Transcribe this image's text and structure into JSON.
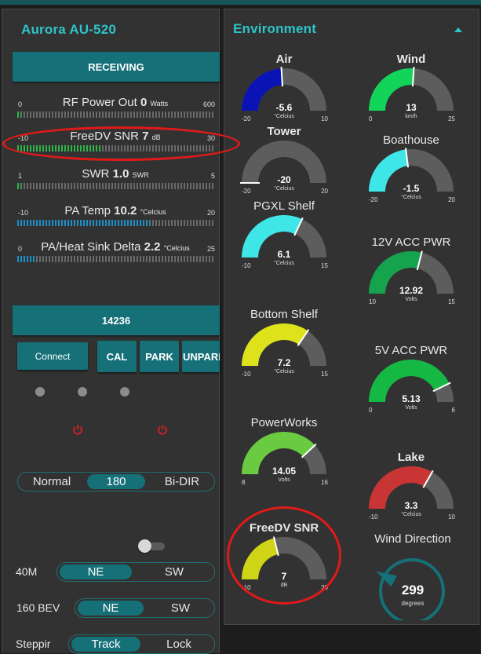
{
  "colors": {
    "accent": "#157078",
    "title": "#2ec4c9",
    "panel": "#323232",
    "highlight": "#e01a1a"
  },
  "left": {
    "title": "Aurora AU-520",
    "status": "RECEIVING",
    "meters": [
      {
        "label": "RF Power Out ",
        "value": "0",
        "unit": "Watts",
        "min": "0",
        "max": "600",
        "fill": 0.0,
        "color": "#2fb54a"
      },
      {
        "label": "FreeDV SNR ",
        "value": "7",
        "unit": "dB",
        "min": "-10",
        "max": "30",
        "fill": 0.42,
        "color": "#2fb54a"
      },
      {
        "label": "SWR ",
        "value": "1.0",
        "unit": "SWR",
        "min": "1",
        "max": "5",
        "fill": 0.02,
        "color": "#2fb54a"
      },
      {
        "label": "PA Temp ",
        "value": "10.2",
        "unit": "°Celcius",
        "min": "-10",
        "max": "20",
        "fill": 0.67,
        "color": "#1f8fc9"
      },
      {
        "label": "PA/Heat Sink Delta ",
        "value": "2.2",
        "unit": "°Celcius",
        "min": "0",
        "max": "25",
        "fill": 0.09,
        "color": "#1f8fc9"
      }
    ],
    "frequency": "14236",
    "buttons": {
      "connect": "Connect",
      "cal": "CAL",
      "park": "PARK",
      "unpark": "UNPARK"
    },
    "mode": {
      "left": "Normal",
      "middle": "180",
      "right": "Bi-DIR"
    },
    "rows": [
      {
        "label": "40M",
        "a": "NE",
        "b": "SW"
      },
      {
        "label": "160 BEV",
        "a": "NE",
        "b": "SW"
      },
      {
        "label": "Steppir",
        "a": "Track",
        "b": "Lock"
      }
    ]
  },
  "environment": {
    "title": "Environment",
    "collapse_icon": "caret-up-icon",
    "gauges": [
      {
        "title": "Air",
        "value": "-5.6",
        "unit": "°Celcius",
        "min": "-20",
        "max": "10",
        "fraction": 0.48,
        "color": "#0a14b4"
      },
      {
        "title": "Wind",
        "value": "13",
        "unit": "km/h",
        "min": "0",
        "max": "25",
        "fraction": 0.52,
        "color": "#12d45a"
      },
      {
        "title": "Tower",
        "value": "-20",
        "unit": "°Celcius",
        "min": "-20",
        "max": "20",
        "fraction": 0.0,
        "color": "#e0e0e0"
      },
      {
        "title": "Boathouse",
        "value": "-1.5",
        "unit": "°Celcius",
        "min": "-20",
        "max": "20",
        "fraction": 0.46,
        "color": "#3ee6e8"
      },
      {
        "title": "PGXL Shelf",
        "value": "6.1",
        "unit": "°Celcius",
        "min": "-10",
        "max": "15",
        "fraction": 0.64,
        "color": "#3ee6e8"
      },
      {
        "title": "12V ACC PWR",
        "value": "12.92",
        "unit": "Volts",
        "min": "10",
        "max": "15",
        "fraction": 0.58,
        "color": "#16a34e"
      },
      {
        "title": "Bottom Shelf",
        "value": "7.2",
        "unit": "°Celcius",
        "min": "-10",
        "max": "15",
        "fraction": 0.69,
        "color": "#dde21a"
      },
      {
        "title": "5V ACC PWR",
        "value": "5.13",
        "unit": "Volts",
        "min": "0",
        "max": "6",
        "fraction": 0.855,
        "color": "#16b844"
      },
      {
        "title": "PowerWorks",
        "value": "14.05",
        "unit": "Volts",
        "min": "8",
        "max": "16",
        "fraction": 0.76,
        "color": "#6acb40"
      },
      {
        "title": "Lake",
        "value": "3.3",
        "unit": "°Celcius",
        "min": "-10",
        "max": "10",
        "fraction": 0.665,
        "color": "#c93434"
      },
      {
        "title": "FreeDV SNR",
        "value": "7",
        "unit": "dB",
        "min": "-10",
        "max": "30",
        "fraction": 0.425,
        "color": "#cfd416"
      }
    ],
    "wind_direction": {
      "title": "Wind Direction",
      "value": "299",
      "unit": "degrees",
      "degrees": 299
    }
  }
}
